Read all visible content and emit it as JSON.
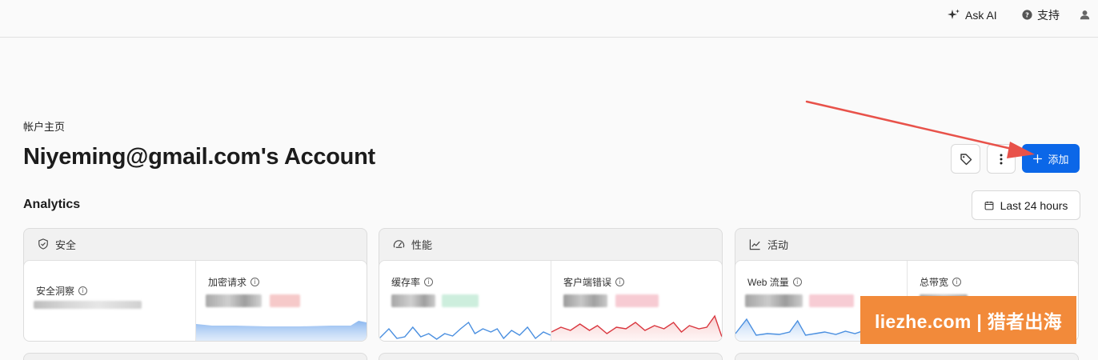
{
  "topbar": {
    "ask_ai": "Ask AI",
    "support": "支持"
  },
  "header": {
    "breadcrumb": "帐户主页",
    "title": "Niyeming@gmail.com's Account",
    "add_label": "添加"
  },
  "analytics": {
    "title": "Analytics",
    "range_label": "Last 24 hours",
    "cards": [
      {
        "title": "安全",
        "icon": "shield-check-icon",
        "metrics": [
          {
            "label": "安全洞察"
          },
          {
            "label": "加密请求"
          }
        ]
      },
      {
        "title": "性能",
        "icon": "gauge-icon",
        "metrics": [
          {
            "label": "缓存率"
          },
          {
            "label": "客户端错误"
          }
        ]
      },
      {
        "title": "活动",
        "icon": "line-chart-icon",
        "metrics": [
          {
            "label": "Web 流量"
          },
          {
            "label": "总带宽"
          }
        ]
      }
    ]
  },
  "watermark": "liezhe.com | 猎者出海",
  "colors": {
    "primary": "#0b67e8",
    "arrow": "#e8524a",
    "sparkline_blue": "#4a8fe0",
    "sparkline_red": "#d9363e",
    "watermark_bg": "#f28a3a"
  }
}
